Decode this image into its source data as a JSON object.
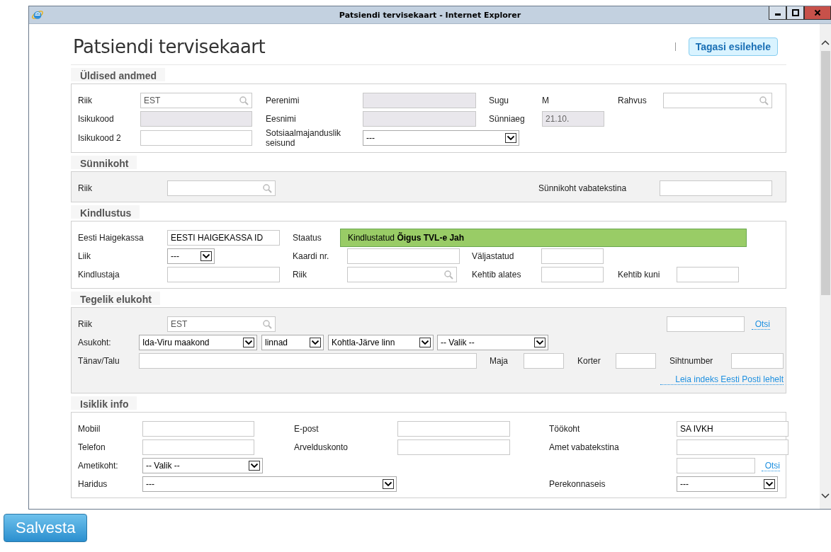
{
  "window": {
    "title": "Patsiendi tervisekaart - Internet Explorer"
  },
  "page": {
    "title": "Patsiendi tervisekaart",
    "back_button": "Tagasi esilehele"
  },
  "sections": [
    {
      "title": "Üldised andmed",
      "rows": [
        [
          {
            "kind": "label",
            "text": "Riik"
          },
          {
            "kind": "search",
            "value": "EST"
          },
          {
            "kind": "label",
            "text": "Perenimi"
          },
          {
            "kind": "disabled"
          },
          {
            "kind": "label",
            "text": "Sugu"
          },
          {
            "kind": "value",
            "text": "M"
          },
          {
            "kind": "label",
            "text": "Rahvus"
          },
          {
            "kind": "search"
          }
        ],
        [
          {
            "kind": "label",
            "text": "Isikukood"
          },
          {
            "kind": "disabled"
          },
          {
            "kind": "label",
            "text": "Eesnimi"
          },
          {
            "kind": "disabled"
          },
          {
            "kind": "label",
            "text": "Sünniaeg"
          },
          {
            "kind": "disabled",
            "value": "21.10."
          }
        ],
        [
          {
            "kind": "label",
            "text": "Isikukood 2"
          },
          {
            "kind": "input"
          },
          {
            "kind": "label",
            "text": "Sotsiaalmajanduslik seisund"
          },
          {
            "kind": "select",
            "value": "---"
          }
        ]
      ]
    },
    {
      "title": "Sünnikoht",
      "rows": [
        [
          {
            "kind": "label",
            "text": "Riik"
          },
          {
            "kind": "search"
          },
          {
            "kind": "label",
            "text": "Sünnikoht vabatekstina"
          },
          {
            "kind": "input"
          }
        ]
      ]
    },
    {
      "title": "Kindlustus",
      "rows": [
        [
          {
            "kind": "label",
            "text": "Eesti Haigekassa"
          },
          {
            "kind": "input",
            "value": "EESTI HAIGEKASSA ID"
          },
          {
            "kind": "label",
            "text": "Staatus"
          },
          {
            "kind": "status",
            "text": "Kindlustatud **Õigus TVL-e Jah**"
          }
        ],
        [
          {
            "kind": "label",
            "text": "Liik"
          },
          {
            "kind": "select",
            "value": "---"
          },
          {
            "kind": "label",
            "text": "Kaardi nr."
          },
          {
            "kind": "input"
          },
          {
            "kind": "label",
            "text": "Väljastatud"
          },
          {
            "kind": "input"
          }
        ],
        [
          {
            "kind": "label",
            "text": "Kindlustaja"
          },
          {
            "kind": "input"
          },
          {
            "kind": "label",
            "text": "Riik"
          },
          {
            "kind": "search"
          },
          {
            "kind": "label",
            "text": "Kehtib alates"
          },
          {
            "kind": "input"
          },
          {
            "kind": "label",
            "text": "Kehtib kuni"
          },
          {
            "kind": "input"
          }
        ]
      ]
    },
    {
      "title": "Tegelik elukoht",
      "rows": [
        [
          {
            "kind": "label",
            "text": "Riik"
          },
          {
            "kind": "search",
            "value": "EST"
          },
          {
            "kind": "input"
          },
          {
            "kind": "link",
            "text": "Otsi"
          }
        ],
        [
          {
            "kind": "label",
            "text": "Asukoht:"
          },
          {
            "kind": "select",
            "value": "Ida-Viru maakond"
          },
          {
            "kind": "select",
            "value": "linnad"
          },
          {
            "kind": "select",
            "value": "Kohtla-Järve linn"
          },
          {
            "kind": "select",
            "value": "-- Valik --"
          }
        ],
        [
          {
            "kind": "label",
            "text": "Tänav/Talu"
          },
          {
            "kind": "input"
          },
          {
            "kind": "label",
            "text": "Maja"
          },
          {
            "kind": "input"
          },
          {
            "kind": "label",
            "text": "Korter"
          },
          {
            "kind": "input"
          },
          {
            "kind": "label",
            "text": "Sihtnumber"
          },
          {
            "kind": "input"
          }
        ],
        [
          {
            "kind": "gap"
          },
          {
            "kind": "gap"
          },
          {
            "kind": "gap"
          },
          {
            "kind": "gap"
          },
          {
            "kind": "gap"
          },
          {
            "kind": "gap"
          },
          {
            "kind": "link",
            "text": "Leia indeks Eesti Posti lehelt"
          }
        ]
      ]
    },
    {
      "title": "Isiklik info",
      "rows": [
        [
          {
            "kind": "label",
            "text": "Mobiil"
          },
          {
            "kind": "input"
          },
          {
            "kind": "label",
            "text": "E-post"
          },
          {
            "kind": "input"
          },
          {
            "kind": "label",
            "text": "Töökoht"
          },
          {
            "kind": "input",
            "value": "SA IVKH"
          }
        ],
        [
          {
            "kind": "label",
            "text": "Telefon"
          },
          {
            "kind": "input"
          },
          {
            "kind": "label",
            "text": "Arvelduskonto"
          },
          {
            "kind": "input"
          },
          {
            "kind": "label",
            "text": "Amet vabatekstina"
          },
          {
            "kind": "input"
          }
        ],
        [
          {
            "kind": "label",
            "text": "Ametikoht:"
          },
          {
            "kind": "select",
            "value": "-- Valik --"
          },
          {
            "kind": "input"
          },
          {
            "kind": "link",
            "text": "Otsi"
          }
        ],
        [
          {
            "kind": "label",
            "text": "Haridus"
          },
          {
            "kind": "select",
            "value": "---"
          },
          {
            "kind": "gap"
          },
          {
            "kind": "gap"
          },
          {
            "kind": "label",
            "text": "Perekonnaseis"
          },
          {
            "kind": "select",
            "value": "---"
          }
        ]
      ]
    }
  ],
  "save_button": "Salvesta"
}
